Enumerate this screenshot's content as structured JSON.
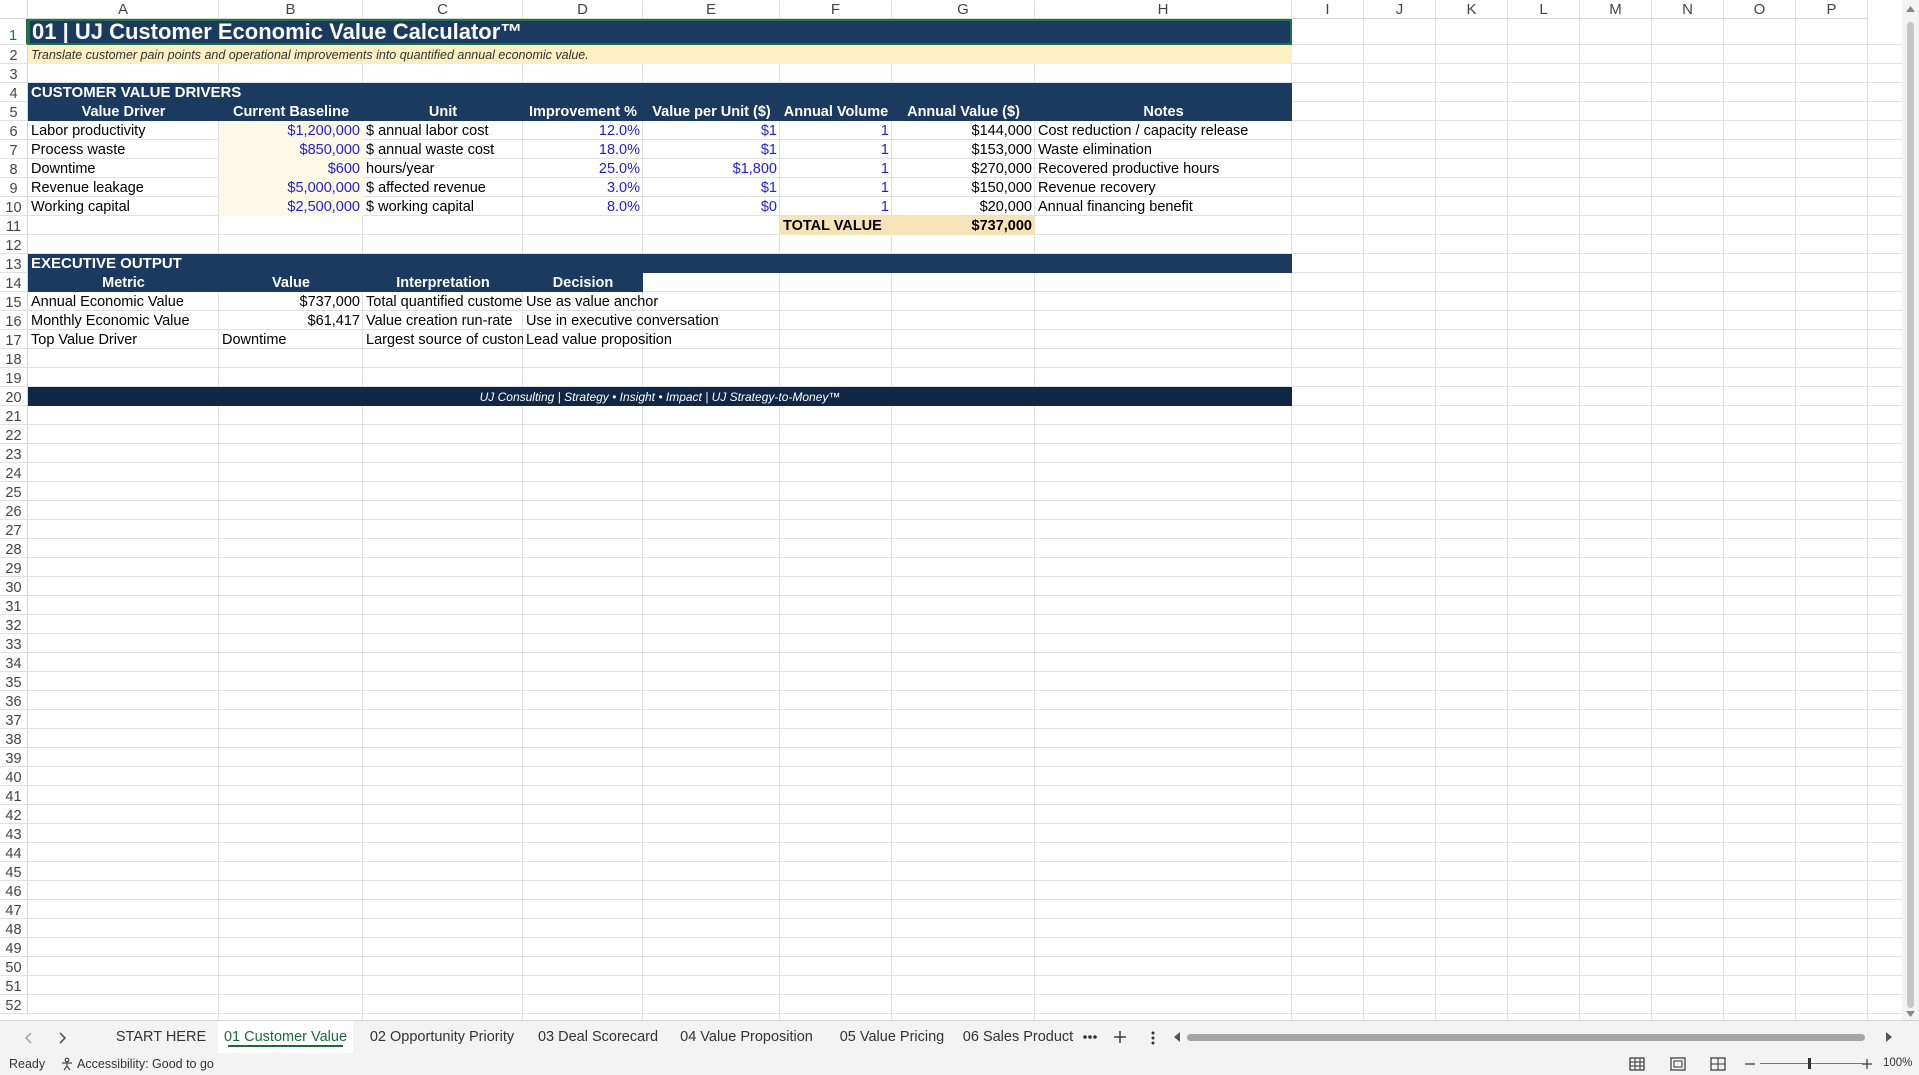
{
  "columns": [
    "A",
    "B",
    "C",
    "D",
    "E",
    "F",
    "G",
    "H",
    "I",
    "J",
    "K",
    "L",
    "M",
    "N",
    "O",
    "P"
  ],
  "rows": [
    "1",
    "2",
    "3",
    "4",
    "5",
    "6",
    "7",
    "8",
    "9",
    "10",
    "11",
    "12",
    "13",
    "14",
    "15",
    "16",
    "17",
    "18",
    "19",
    "20",
    "21",
    "22",
    "23",
    "24",
    "25",
    "26",
    "27",
    "28",
    "29",
    "30",
    "31",
    "32",
    "33",
    "34",
    "35",
    "36",
    "37",
    "38",
    "39",
    "40",
    "41",
    "42",
    "43",
    "44",
    "45",
    "46",
    "47",
    "48",
    "49",
    "50",
    "51",
    "52"
  ],
  "sheet": {
    "title": "01 | UJ Customer Economic Value Calculator™",
    "subtitle": "Translate customer pain points and operational improvements into quantified annual economic value.",
    "drivers_section": "CUSTOMER VALUE DRIVERS",
    "drivers_headers": [
      "Value Driver",
      "Current Baseline",
      "Unit",
      "Improvement %",
      "Value per Unit ($)",
      "Annual Volume",
      "Annual Value ($)",
      "Notes"
    ],
    "drivers": [
      [
        "Labor productivity",
        "$1,200,000",
        "$ annual labor cost",
        "12.0%",
        "$1",
        "1",
        "$144,000",
        "Cost reduction / capacity release"
      ],
      [
        "Process waste",
        "$850,000",
        "$ annual waste cost",
        "18.0%",
        "$1",
        "1",
        "$153,000",
        "Waste elimination"
      ],
      [
        "Downtime",
        "$600",
        "hours/year",
        "25.0%",
        "$1,800",
        "1",
        "$270,000",
        "Recovered productive hours"
      ],
      [
        "Revenue leakage",
        "$5,000,000",
        "$ affected revenue",
        "3.0%",
        "$1",
        "1",
        "$150,000",
        "Revenue recovery"
      ],
      [
        "Working capital",
        "$2,500,000",
        "$ working capital",
        "8.0%",
        "$0",
        "1",
        "$20,000",
        "Annual financing benefit"
      ]
    ],
    "total_label": "TOTAL VALUE",
    "total_value": "$737,000",
    "exec_section": "EXECUTIVE OUTPUT",
    "exec_headers": [
      "Metric",
      "Value",
      "Interpretation",
      "Decision"
    ],
    "exec_rows": [
      [
        "Annual Economic Value",
        "$737,000",
        "Total quantified customer",
        "Use as value anchor"
      ],
      [
        "Monthly Economic Value",
        "$61,417",
        "Value creation run-rate",
        "Use in executive conversation"
      ],
      [
        "Top Value Driver",
        "Downtime",
        "Largest source of customer",
        "Lead value proposition"
      ]
    ],
    "footer": "UJ Consulting | Strategy • Insight • Impact | UJ Strategy-to-Money™"
  },
  "tabs": {
    "items": [
      "START HERE",
      "01 Customer Value",
      "02 Opportunity Priority",
      "03 Deal Scorecard",
      "04 Value Proposition",
      "05 Value Pricing",
      "06 Sales Product"
    ],
    "active": "01 Customer Value"
  },
  "status": {
    "ready": "Ready",
    "accessibility": "Accessibility: Good to go",
    "zoom": "100%"
  },
  "colors": {
    "navy": "#1b3a5f",
    "input_fill": "#fdf9e6",
    "total_fill": "#f6e3b8",
    "excel_green": "#217346",
    "input_text": "#1f1fd8"
  }
}
